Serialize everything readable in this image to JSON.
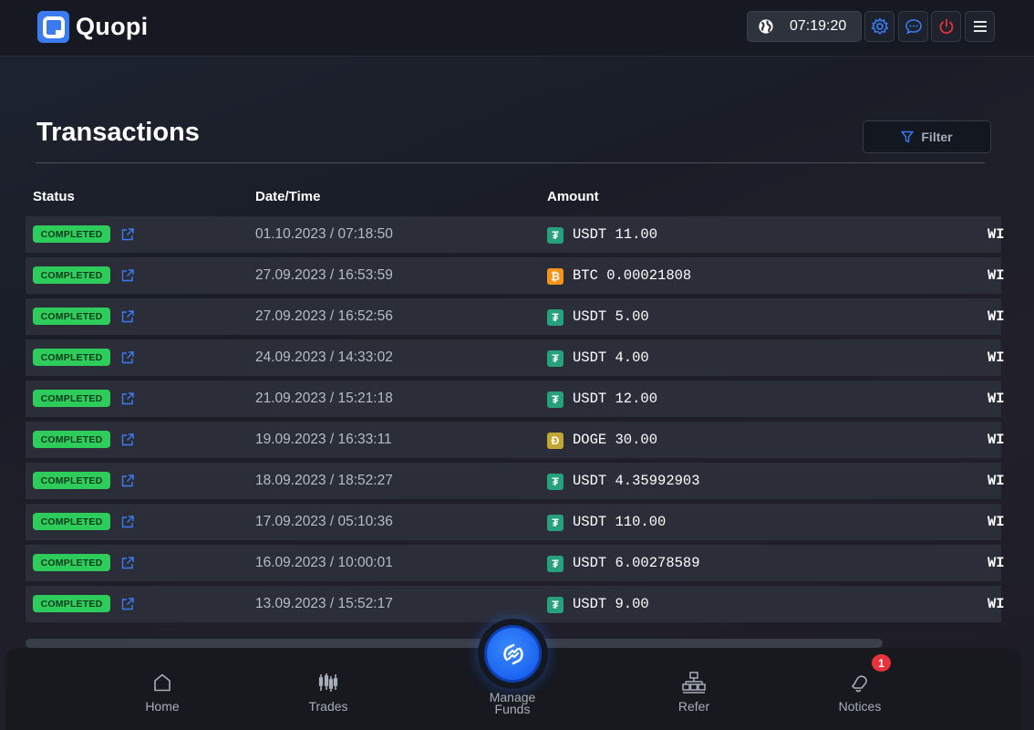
{
  "header": {
    "logo_text": "Quopi",
    "clock": "07:19:20"
  },
  "page": {
    "title": "Transactions",
    "filter_label": "Filter"
  },
  "table": {
    "columns": [
      "Status",
      "Date/Time",
      "Amount"
    ],
    "rows": [
      {
        "status": "COMPLETED",
        "datetime": "01.10.2023 / 07:18:50",
        "coin": "USDT",
        "amount": "USDT 11.00",
        "type": "WI"
      },
      {
        "status": "COMPLETED",
        "datetime": "27.09.2023 / 16:53:59",
        "coin": "BTC",
        "amount": "BTC 0.00021808",
        "type": "WI"
      },
      {
        "status": "COMPLETED",
        "datetime": "27.09.2023 / 16:52:56",
        "coin": "USDT",
        "amount": "USDT 5.00",
        "type": "WI"
      },
      {
        "status": "COMPLETED",
        "datetime": "24.09.2023 / 14:33:02",
        "coin": "USDT",
        "amount": "USDT 4.00",
        "type": "WI"
      },
      {
        "status": "COMPLETED",
        "datetime": "21.09.2023 / 15:21:18",
        "coin": "USDT",
        "amount": "USDT 12.00",
        "type": "WI"
      },
      {
        "status": "COMPLETED",
        "datetime": "19.09.2023 / 16:33:11",
        "coin": "DOGE",
        "amount": "DOGE 30.00",
        "type": "WI"
      },
      {
        "status": "COMPLETED",
        "datetime": "18.09.2023 / 18:52:27",
        "coin": "USDT",
        "amount": "USDT 4.35992903",
        "type": "WI"
      },
      {
        "status": "COMPLETED",
        "datetime": "17.09.2023 / 05:10:36",
        "coin": "USDT",
        "amount": "USDT 110.00",
        "type": "WI"
      },
      {
        "status": "COMPLETED",
        "datetime": "16.09.2023 / 10:00:01",
        "coin": "USDT",
        "amount": "USDT 6.00278589",
        "type": "WI"
      },
      {
        "status": "COMPLETED",
        "datetime": "13.09.2023 / 15:52:17",
        "coin": "USDT",
        "amount": "USDT 9.00",
        "type": "WI"
      }
    ]
  },
  "coin_colors": {
    "USDT": "#26a17b",
    "BTC": "#f7931a",
    "DOGE": "#c2a633"
  },
  "coin_glyphs": {
    "USDT": "₮",
    "BTC": "₿",
    "DOGE": "Ð"
  },
  "nav": {
    "home": "Home",
    "trades": "Trades",
    "manage_funds": "Manage Funds",
    "refer": "Refer",
    "notices": "Notices",
    "notices_count": "1"
  },
  "colors": {
    "accent": "#3a7bf2",
    "status_completed": "#2ecc5b",
    "notice_badge": "#e8323c"
  }
}
